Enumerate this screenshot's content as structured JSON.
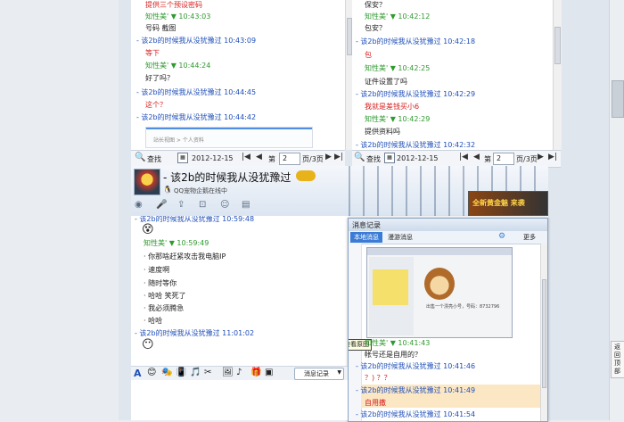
{
  "left_chat": {
    "messages": [
      {
        "text": "提供三个预设密码",
        "color": "red"
      },
      {
        "text": "知性美' ▼ 10:43:03",
        "color": "green"
      },
      {
        "text": "号码     截图",
        "color": "black"
      },
      {
        "text": "- 该2b的时候我从没犹豫过 10:43:09",
        "color": "blue"
      },
      {
        "text": "等下",
        "color": "red"
      },
      {
        "text": "知性美' ▼ 10:44:24",
        "color": "green"
      },
      {
        "text": "好了吗？",
        "color": "black"
      },
      {
        "text": "- 该2b的时候我从没犹豫过 10:44:45",
        "color": "blue"
      },
      {
        "text": "这个？",
        "color": "red"
      },
      {
        "text": "- 该2b的时候我从没犹豫过 10:44:42",
        "color": "blue"
      }
    ],
    "embedded_caption": "站长视图 > 个人资料"
  },
  "right_chat": {
    "messages": [
      {
        "text": "保安？",
        "color": "black"
      },
      {
        "text": "知性美' ▼ 10:42:12",
        "color": "green"
      },
      {
        "text": "包安？",
        "color": "black"
      },
      {
        "text": "- 该2b的时候我从没犹豫过 10:42:18",
        "color": "blue"
      },
      {
        "text": "包",
        "color": "red"
      },
      {
        "text": "知性美' ▼ 10:42:25",
        "color": "green"
      },
      {
        "text": "证件设置了吗",
        "color": "black"
      },
      {
        "text": "- 该2b的时候我从没犹豫过 10:42:29",
        "color": "blue"
      },
      {
        "text": "我就是差钱买小6",
        "color": "red"
      },
      {
        "text": "知性美' ▼ 10:42:29",
        "color": "green"
      },
      {
        "text": "提供资料吗",
        "color": "black"
      },
      {
        "text": "- 该2b的时候我从没犹豫过 10:42:32",
        "color": "blue"
      }
    ]
  },
  "history_bar": {
    "search_label": "查找",
    "date": "2012-12-15",
    "page_prefix": "第",
    "page_value": "2",
    "page_suffix": "页/3页"
  },
  "main_chat": {
    "title": "- 该2b的时候我从没犹豫过",
    "status": "QQ宠物企鹅在线中",
    "ad_text": "全新黄金魅 来袭",
    "messages": [
      {
        "text": "- 该2b的时候我从没犹豫过 10:59:48",
        "color": "blue"
      },
      {
        "text": "知性美' ▼ 10:59:49",
        "color": "green"
      },
      {
        "text": "· 你那啥赶紧攻击我电脑IP",
        "color": "black"
      },
      {
        "text": "· 速度啊",
        "color": "black"
      },
      {
        "text": "· 随时等你",
        "color": "black"
      },
      {
        "text": "·  哈哈  笑死了",
        "color": "black"
      },
      {
        "text": "· 我必须腾急",
        "color": "black"
      },
      {
        "text": "· 哈哈",
        "color": "black"
      },
      {
        "text": "- 该2b的时候我从没犹豫过 11:01:02",
        "color": "blue"
      }
    ],
    "history_button": "消息记录"
  },
  "history_window": {
    "title": "消息记录",
    "tab_active": "本地消息",
    "tab_other": "漫游消息",
    "more_label": "更多",
    "tooltip": "点击查看原图",
    "messages": [
      {
        "text": "知性美' ▼ 10:41:43",
        "color": "green"
      },
      {
        "text": "帐号还是自用的？",
        "color": "black"
      },
      {
        "text": "- 该2b的时候我从没犹豫过 10:41:46",
        "color": "blue"
      },
      {
        "text": "？) ？？",
        "color": "red"
      },
      {
        "text": "- 该2b的时候我从没犹豫过 10:41:49",
        "color": "blue"
      },
      {
        "text": "自用撒",
        "color": "red"
      },
      {
        "text": "- 该2b的时候我从没犹豫过 10:41:54",
        "color": "blue"
      }
    ],
    "thumb_caption": "出售一个漂亮小号，号码：8732796"
  },
  "right_scroll_label": "返回顶部",
  "colors": {
    "blue": "#1f4fb8",
    "green": "#2f9a2f",
    "red": "#d62020",
    "title_bar": "#dfe8f3",
    "accent": "#3a7bd5"
  }
}
